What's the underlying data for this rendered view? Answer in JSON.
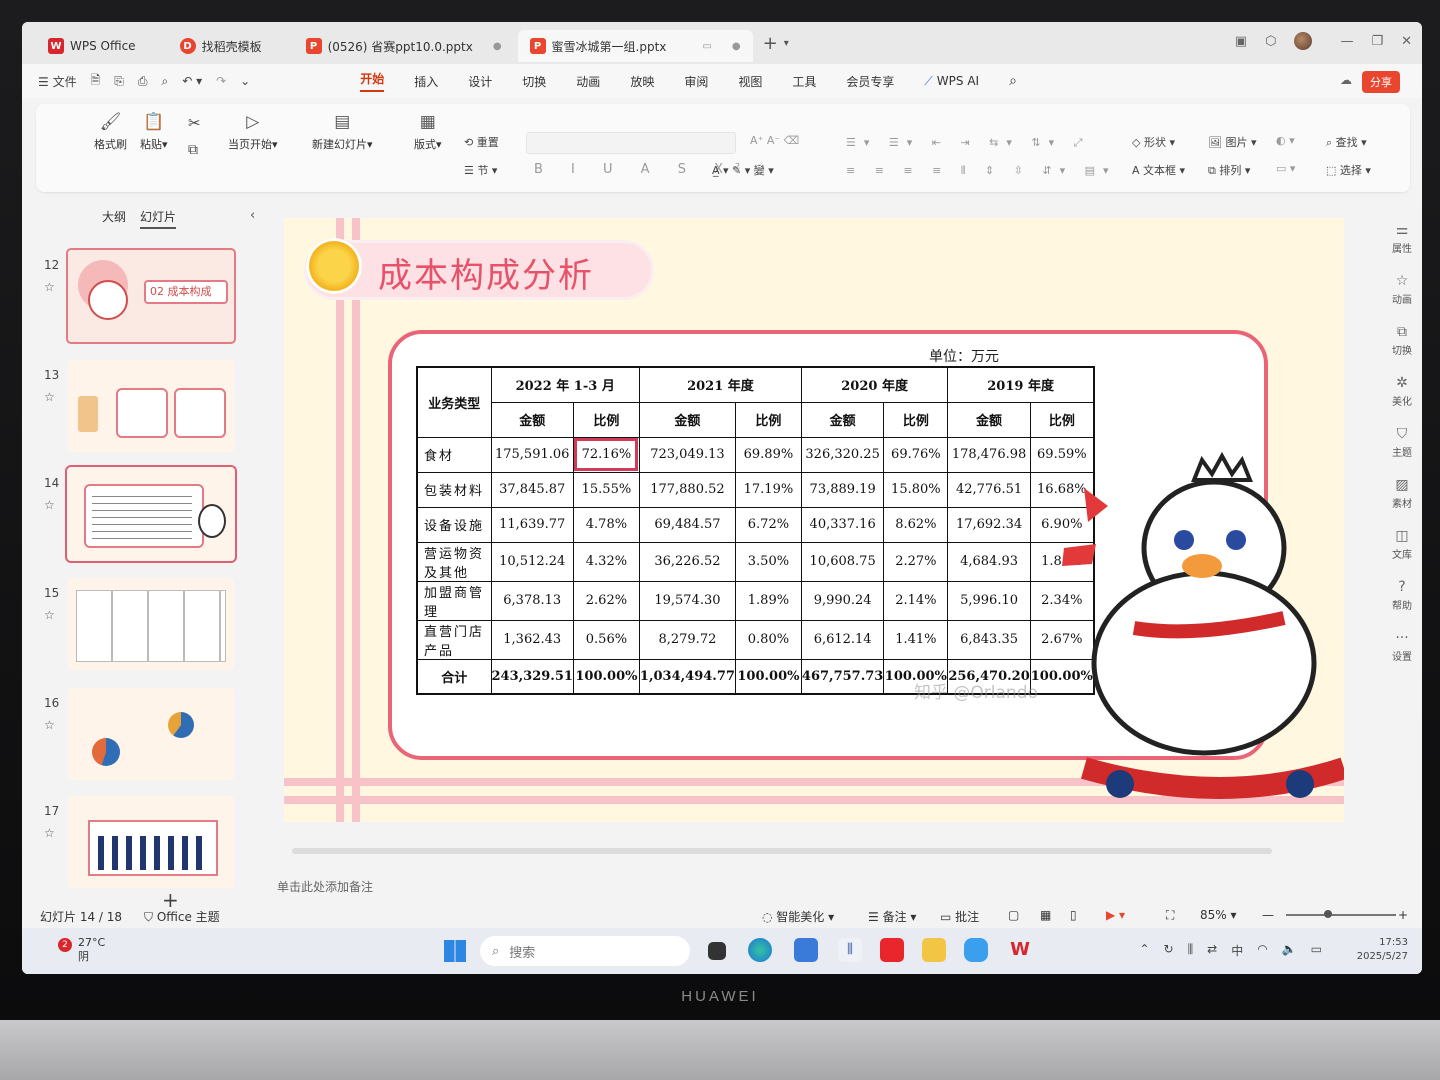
{
  "tabs": [
    {
      "label": "WPS Office",
      "logo": "W",
      "color": "#d9262c"
    },
    {
      "label": "找稻壳模板",
      "logo": "D",
      "color": "#e8462f"
    },
    {
      "label": "(0526) 省赛ppt10.0.pptx",
      "logo": "P",
      "color": "#e8462f"
    },
    {
      "label": "蜜雪冰城第一组.pptx",
      "logo": "P",
      "color": "#e8462f"
    }
  ],
  "menu": {
    "file": "文件",
    "tabs": [
      "开始",
      "插入",
      "设计",
      "切换",
      "动画",
      "放映",
      "审阅",
      "视图",
      "工具",
      "会员专享"
    ],
    "wps_ai": "WPS AI",
    "share": "分享"
  },
  "ribbon": {
    "format_painter": "格式刷",
    "paste": "粘贴",
    "from_current": "当页开始",
    "new_slide": "新建幻灯片",
    "layout": "版式",
    "reset": "重置",
    "section": "节",
    "shape": "形状",
    "picture": "图片",
    "find": "查找",
    "textbox": "文本框",
    "arrange": "排列",
    "select": "选择"
  },
  "sidepanel": {
    "outline_tab": "大纲",
    "slides_tab": "幻灯片",
    "thumbs": [
      {
        "num": "12",
        "text": "02 成本构成"
      },
      {
        "num": "13",
        "text": ""
      },
      {
        "num": "14",
        "text": ""
      },
      {
        "num": "15",
        "text": ""
      },
      {
        "num": "16",
        "text": ""
      },
      {
        "num": "17",
        "text": ""
      }
    ]
  },
  "rightbar": [
    "属性",
    "动画",
    "切换",
    "美化",
    "主题",
    "素材",
    "文库",
    "帮助",
    "设置"
  ],
  "slide": {
    "title": "成本构成分析",
    "unit": "单位：万元",
    "watermark": "知乎 @Orlando",
    "table": {
      "row_header": "业务类型",
      "years": [
        "2022 年 1-3 月",
        "2021 年度",
        "2020 年度",
        "2019 年度"
      ],
      "sub": [
        "金额",
        "比例"
      ],
      "rows": [
        {
          "label": "食材",
          "cells": [
            "175,591.06",
            "72.16%",
            "723,049.13",
            "69.89%",
            "326,320.25",
            "69.76%",
            "178,476.98",
            "69.59%"
          ]
        },
        {
          "label": "包装材料",
          "cells": [
            "37,845.87",
            "15.55%",
            "177,880.52",
            "17.19%",
            "73,889.19",
            "15.80%",
            "42,776.51",
            "16.68%"
          ]
        },
        {
          "label": "设备设施",
          "cells": [
            "11,639.77",
            "4.78%",
            "69,484.57",
            "6.72%",
            "40,337.16",
            "8.62%",
            "17,692.34",
            "6.90%"
          ]
        },
        {
          "label": "营运物资及其他",
          "cells": [
            "10,512.24",
            "4.32%",
            "36,226.52",
            "3.50%",
            "10,608.75",
            "2.27%",
            "4,684.93",
            "1.83%"
          ]
        },
        {
          "label": "加盟商管理",
          "cells": [
            "6,378.13",
            "2.62%",
            "19,574.30",
            "1.89%",
            "9,990.24",
            "2.14%",
            "5,996.10",
            "2.34%"
          ]
        },
        {
          "label": "直营门店产品",
          "cells": [
            "1,362.43",
            "0.56%",
            "8,279.72",
            "0.80%",
            "6,612.14",
            "1.41%",
            "6,843.35",
            "2.67%"
          ]
        }
      ],
      "total": {
        "label": "合计",
        "cells": [
          "243,329.51",
          "100.00%",
          "1,034,494.77",
          "100.00%",
          "467,757.73",
          "100.00%",
          "256,470.20",
          "100.00%"
        ]
      }
    }
  },
  "notes_placeholder": "单击此处添加备注",
  "status": {
    "slide_count": "幻灯片 14 / 18",
    "theme": "Office 主题",
    "smart_beautify": "智能美化",
    "notes": "备注",
    "comments": "批注",
    "zoom": "85%"
  },
  "taskbar": {
    "temp": "27°C",
    "weather": "阴",
    "weather_badge": "2",
    "search": "搜索",
    "ime": "中",
    "time": "17:53",
    "date": "2025/5/27"
  },
  "brand": "HUAWEI",
  "colors": {
    "accent": "#d4380d",
    "slide_pink": "#ea6478",
    "highlight": "#d23a5a"
  }
}
